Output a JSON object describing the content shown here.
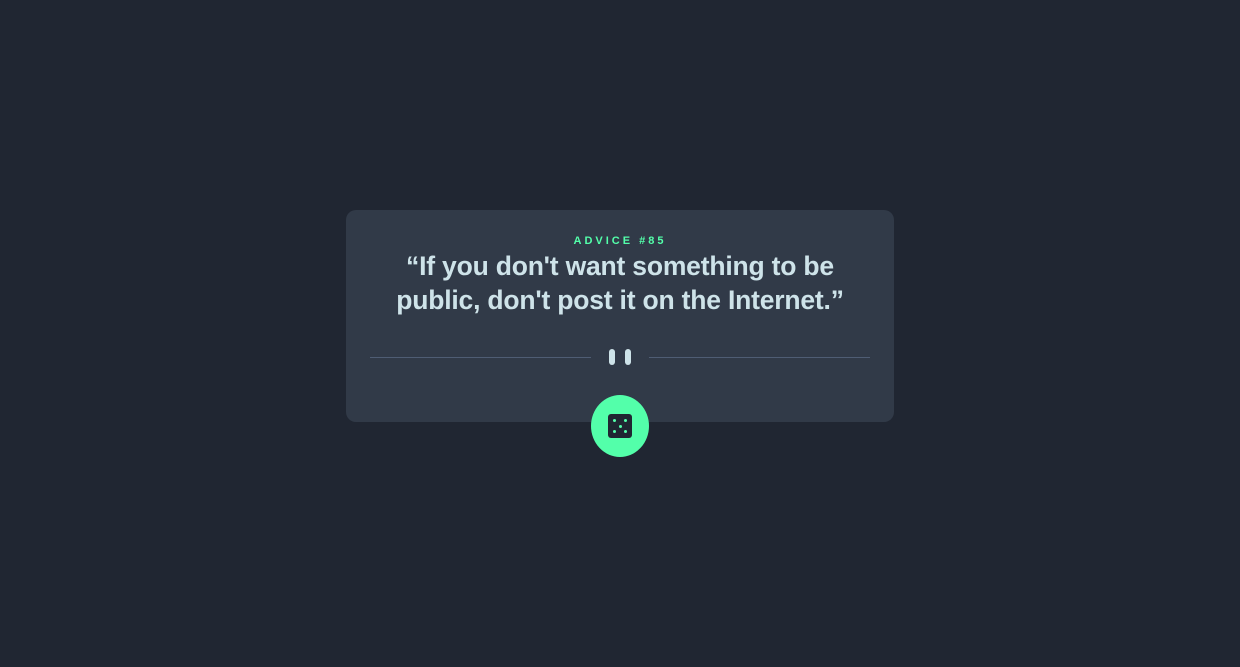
{
  "card": {
    "advice_label": "ADVICE #85",
    "advice_text": "“If you don't want something to be public, don't post it on the Internet.”"
  },
  "divider": {
    "icon": "pause-icon"
  },
  "dice_button": {
    "icon": "dice-icon",
    "aria_label": "Generate new advice"
  },
  "colors": {
    "background": "#202632",
    "card": "#313a48",
    "accent": "#53ffaa",
    "text": "#cee3e9",
    "divider": "#4f5d74"
  }
}
